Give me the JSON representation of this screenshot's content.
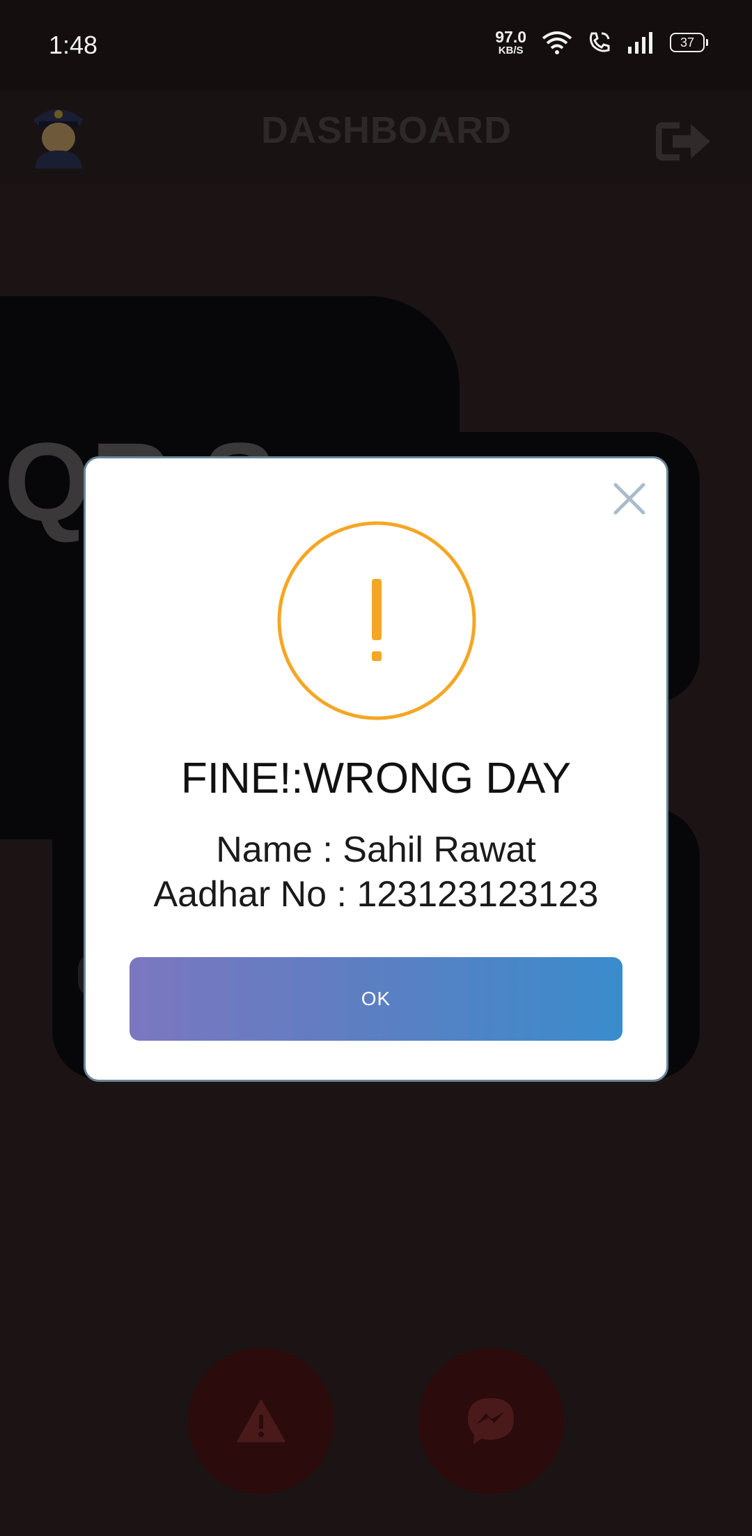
{
  "status_bar": {
    "time": "1:48",
    "net_speed_value": "97.0",
    "net_speed_unit": "KB/S",
    "battery": "37",
    "icons": [
      "wifi-icon",
      "wifi-call-icon",
      "signal-icon",
      "battery-icon"
    ]
  },
  "app_bar": {
    "title": "DASHBOARD",
    "left_icon": "police-officer-avatar",
    "right_icon": "logout-icon"
  },
  "background": {
    "card_text": "QR S"
  },
  "dialog": {
    "icon": "warning-icon",
    "icon_color": "#f5a623",
    "title": "FINE!:WRONG DAY",
    "name_line": "Name : Sahil Rawat",
    "aadhar_line": "Aadhar No : 123123123123",
    "ok_label": "OK",
    "ok_gradient": [
      "#7b77c0",
      "#3a8ccc"
    ]
  },
  "fabs": [
    {
      "icon": "alert-triangle-icon",
      "color": "#2b0b0b"
    },
    {
      "icon": "messenger-icon",
      "color": "#2b0b0b"
    }
  ]
}
